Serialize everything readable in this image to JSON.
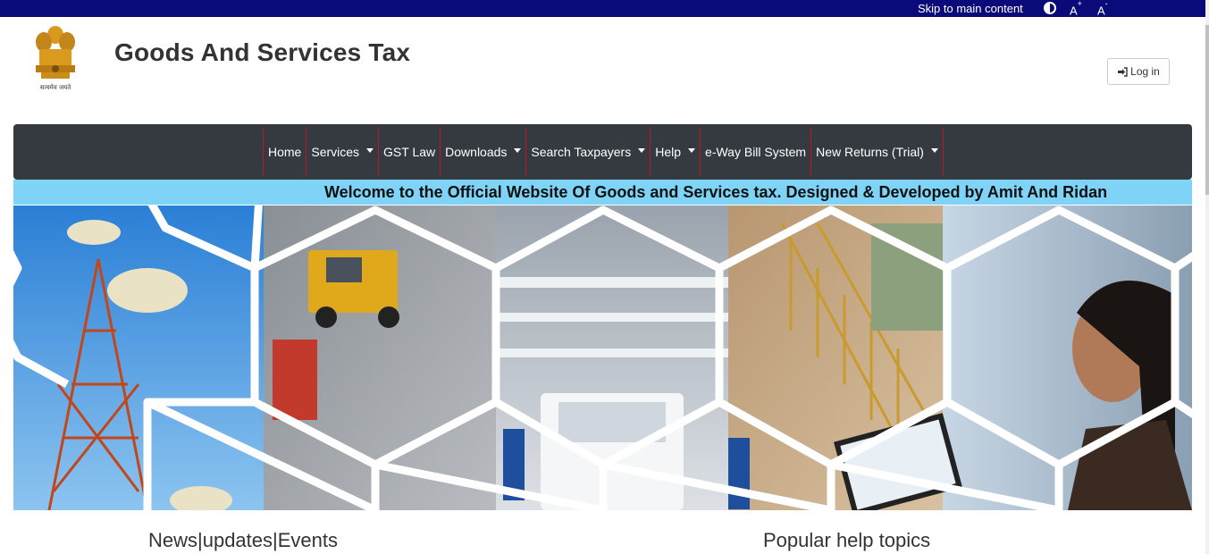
{
  "topbar": {
    "skip_link": "Skip to main content",
    "font_increase": "A",
    "font_increase_sup": "+",
    "font_decrease": "A",
    "font_decrease_sup": "-"
  },
  "header": {
    "emblem_caption": "सत्यमेव जयते",
    "title": "Goods And Services Tax",
    "login_label": "Log in"
  },
  "nav": {
    "items": [
      {
        "label": "Home",
        "dropdown": false
      },
      {
        "label": "Services",
        "dropdown": true
      },
      {
        "label": "GST Law",
        "dropdown": false
      },
      {
        "label": "Downloads",
        "dropdown": true
      },
      {
        "label": "Search Taxpayers",
        "dropdown": true
      },
      {
        "label": "Help",
        "dropdown": true
      },
      {
        "label": "e-Way Bill System",
        "dropdown": false
      },
      {
        "label": "New Returns (Trial)",
        "dropdown": true
      }
    ]
  },
  "marquee": {
    "text": "Welcome to the Official Website Of Goods and Services tax. Designed & Developed by Amit And Ridan"
  },
  "sections": {
    "left_heading": "News|updates|Events",
    "right_heading": "Popular help topics"
  },
  "colors": {
    "topbar": "#0a0a7a",
    "navbar": "#343a40",
    "nav_divider": "#c0161b",
    "marquee_bg": "#7fd3f7"
  }
}
